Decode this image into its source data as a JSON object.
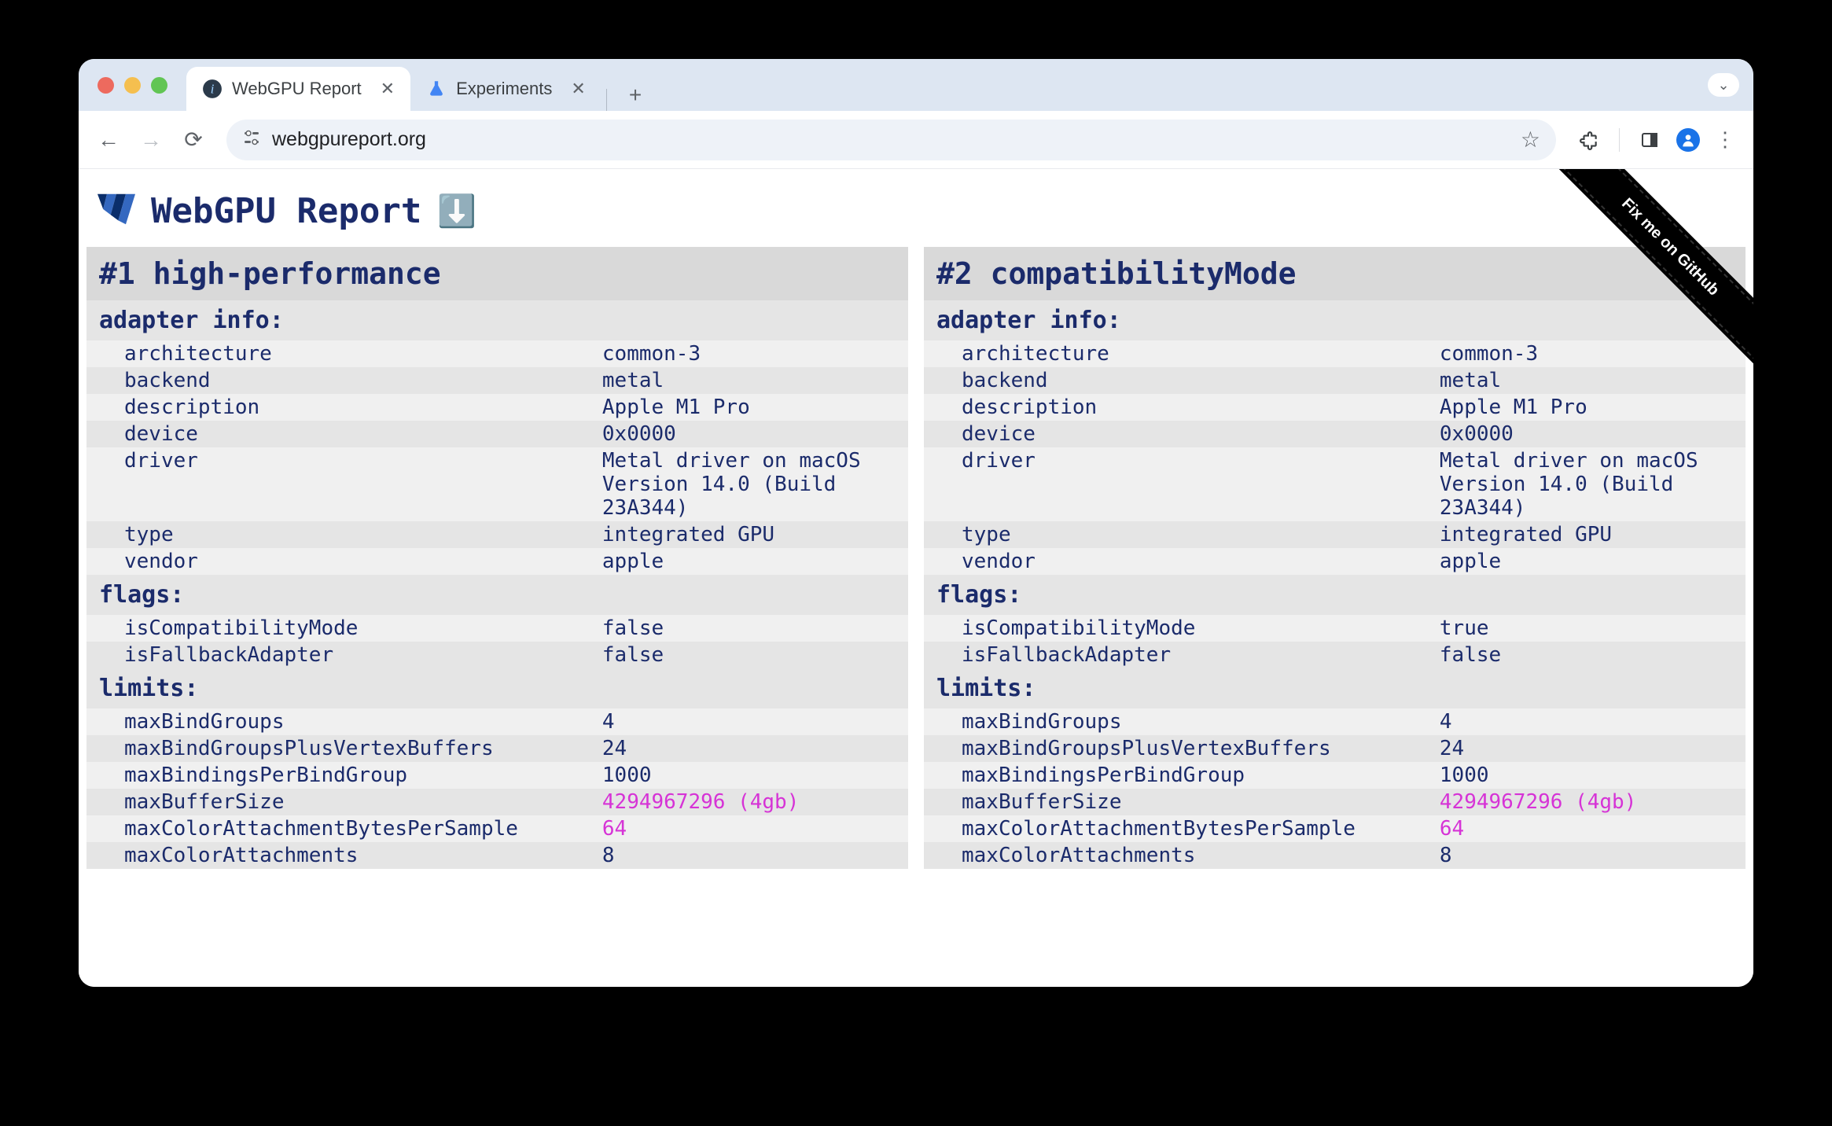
{
  "browser": {
    "tabs": [
      {
        "title": "WebGPU Report",
        "icon": "info",
        "active": true
      },
      {
        "title": "Experiments",
        "icon": "flask",
        "active": false
      }
    ],
    "url": "webgpureport.org"
  },
  "page": {
    "title": "WebGPU Report",
    "github_ribbon": "Fix me on GitHub"
  },
  "columns": [
    {
      "header": "#1 high-performance",
      "sections": [
        {
          "title": "adapter info:",
          "rows": [
            {
              "k": "architecture",
              "v": "common-3"
            },
            {
              "k": "backend",
              "v": "metal"
            },
            {
              "k": "description",
              "v": "Apple M1 Pro"
            },
            {
              "k": "device",
              "v": "0x0000"
            },
            {
              "k": "driver",
              "v": "Metal driver on macOS Version 14.0 (Build 23A344)"
            },
            {
              "k": "type",
              "v": "integrated GPU"
            },
            {
              "k": "vendor",
              "v": "apple"
            }
          ]
        },
        {
          "title": "flags:",
          "rows": [
            {
              "k": "isCompatibilityMode",
              "v": "false"
            },
            {
              "k": "isFallbackAdapter",
              "v": "false"
            }
          ]
        },
        {
          "title": "limits:",
          "rows": [
            {
              "k": "maxBindGroups",
              "v": "4"
            },
            {
              "k": "maxBindGroupsPlusVertexBuffers",
              "v": "24"
            },
            {
              "k": "maxBindingsPerBindGroup",
              "v": "1000"
            },
            {
              "k": "maxBufferSize",
              "v": "4294967296 (4gb)",
              "highlight": true
            },
            {
              "k": "maxColorAttachmentBytesPerSample",
              "v": "64",
              "highlight": true
            },
            {
              "k": "maxColorAttachments",
              "v": "8"
            }
          ]
        }
      ]
    },
    {
      "header": "#2 compatibilityMode",
      "sections": [
        {
          "title": "adapter info:",
          "rows": [
            {
              "k": "architecture",
              "v": "common-3"
            },
            {
              "k": "backend",
              "v": "metal"
            },
            {
              "k": "description",
              "v": "Apple M1 Pro"
            },
            {
              "k": "device",
              "v": "0x0000"
            },
            {
              "k": "driver",
              "v": "Metal driver on macOS Version 14.0 (Build 23A344)"
            },
            {
              "k": "type",
              "v": "integrated GPU"
            },
            {
              "k": "vendor",
              "v": "apple"
            }
          ]
        },
        {
          "title": "flags:",
          "rows": [
            {
              "k": "isCompatibilityMode",
              "v": "true"
            },
            {
              "k": "isFallbackAdapter",
              "v": "false"
            }
          ]
        },
        {
          "title": "limits:",
          "rows": [
            {
              "k": "maxBindGroups",
              "v": "4"
            },
            {
              "k": "maxBindGroupsPlusVertexBuffers",
              "v": "24"
            },
            {
              "k": "maxBindingsPerBindGroup",
              "v": "1000"
            },
            {
              "k": "maxBufferSize",
              "v": "4294967296 (4gb)",
              "highlight": true
            },
            {
              "k": "maxColorAttachmentBytesPerSample",
              "v": "64",
              "highlight": true
            },
            {
              "k": "maxColorAttachments",
              "v": "8"
            }
          ]
        }
      ]
    }
  ]
}
